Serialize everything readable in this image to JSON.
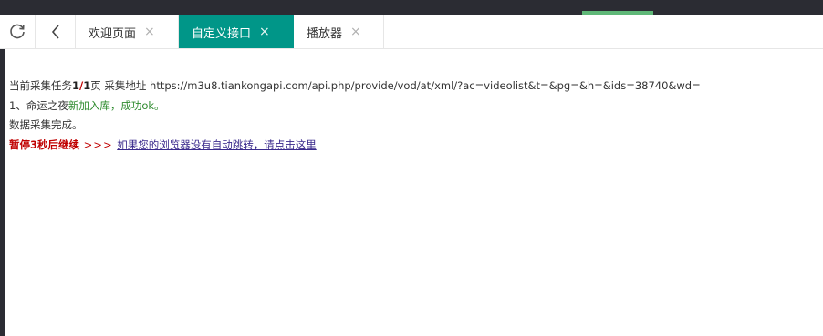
{
  "tabs": {
    "items": [
      {
        "label": "欢迎页面",
        "close": "×",
        "active": false
      },
      {
        "label": "自定义接口",
        "close": "×",
        "active": true
      },
      {
        "label": "播放器",
        "close": "×",
        "active": false
      }
    ]
  },
  "toolbar": {
    "refresh_icon": "refresh-icon",
    "back_icon": "chevron-left-icon"
  },
  "content": {
    "task_prefix": "当前采集任务",
    "task_current": "1",
    "task_sep": "/",
    "task_total": "1",
    "task_page": "页",
    "url_label": " 采集地址 ",
    "url": "https://m3u8.tiankongapi.com/api.php/provide/vod/at/xml/?ac=videolist&t=&pg=&h=&ids=38740&wd=",
    "item_prefix": "1、命运之夜",
    "item_status": "新加入库，成功ok。",
    "done_text": "数据采集完成。",
    "pause_text": "暂停3秒后继续",
    "arrows": " >>> ",
    "redirect_link": "如果您的浏览器没有自动跳转，请点击这里"
  },
  "colors": {
    "accent": "#009688",
    "topbar": "#2b2c33",
    "indicator": "#5fb878",
    "error_red": "#c00000",
    "ok_green": "#2e8b2e"
  }
}
